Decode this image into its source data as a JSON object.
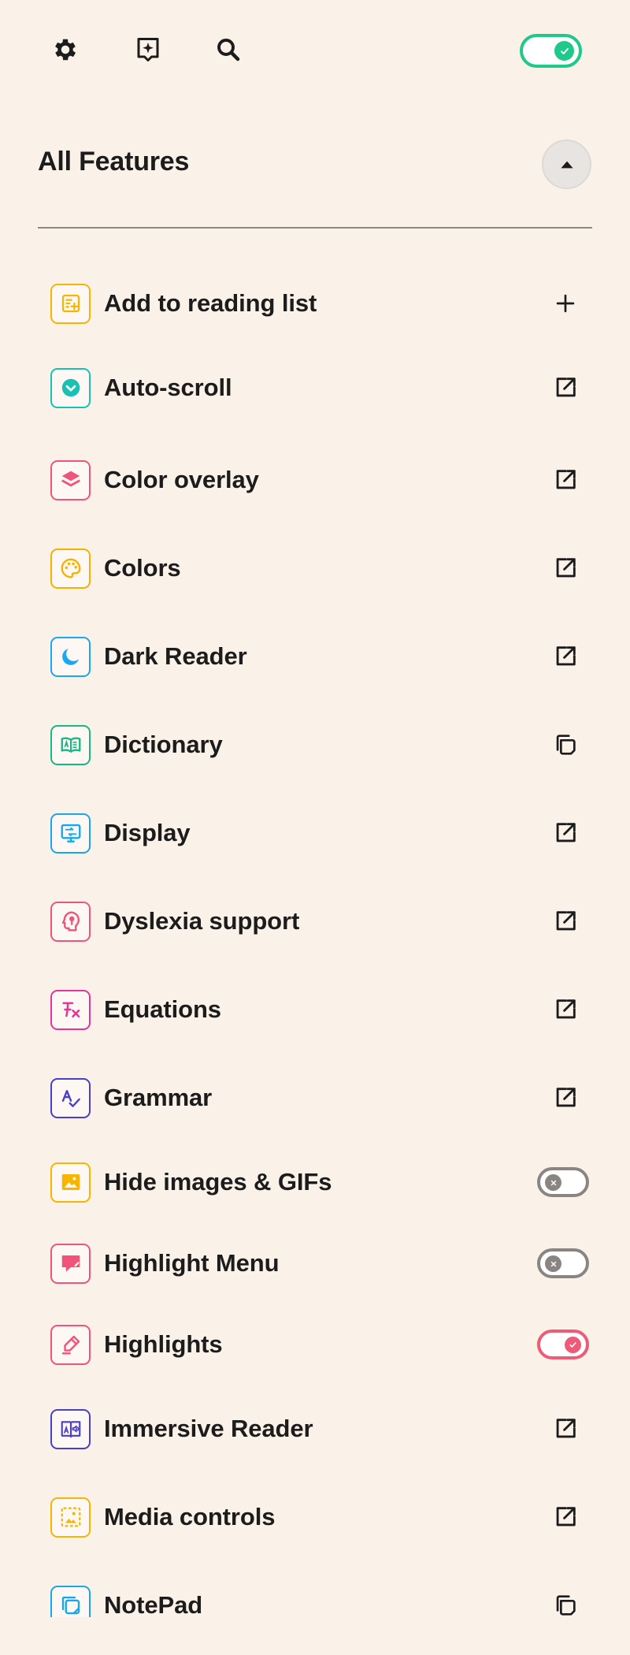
{
  "toolbar": {
    "icons": [
      "gear-icon",
      "sparkle-icon",
      "search-icon"
    ],
    "master_toggle": {
      "state": "on",
      "color": "#1ec98a"
    }
  },
  "section": {
    "title": "All Features",
    "collapse_icon": "caret-up-icon"
  },
  "features": [
    {
      "label": "Add to reading list",
      "icon": "reading-list-icon",
      "color": "#f7b500",
      "action": "add"
    },
    {
      "label": "Auto-scroll",
      "icon": "chevron-circle-icon",
      "color": "#18c1b2",
      "action": "open"
    },
    {
      "label": "Color overlay",
      "icon": "layers-icon",
      "color": "#f1547a",
      "action": "open"
    },
    {
      "label": "Colors",
      "icon": "palette-icon",
      "color": "#f5b100",
      "action": "open"
    },
    {
      "label": "Dark Reader",
      "icon": "moon-icon",
      "color": "#1aa8f0",
      "action": "open"
    },
    {
      "label": "Dictionary",
      "icon": "book-icon",
      "color": "#18b886",
      "action": "copy"
    },
    {
      "label": "Display",
      "icon": "monitor-icon",
      "color": "#19a7ec",
      "action": "open"
    },
    {
      "label": "Dyslexia support",
      "icon": "head-icon",
      "color": "#f1547a",
      "action": "open"
    },
    {
      "label": "Equations",
      "icon": "function-icon",
      "color": "#e6359a",
      "action": "open"
    },
    {
      "label": "Grammar",
      "icon": "spellcheck-icon",
      "color": "#4a3fc9",
      "action": "open"
    },
    {
      "label": "Hide images & GIFs",
      "icon": "image-icon",
      "color": "#f7b500",
      "action": "toggle",
      "state": "off"
    },
    {
      "label": "Highlight Menu",
      "icon": "comment-icon",
      "color": "#f1547a",
      "action": "toggle",
      "state": "off"
    },
    {
      "label": "Highlights",
      "icon": "highlighter-icon",
      "color": "#f1547a",
      "action": "toggle",
      "state": "on"
    },
    {
      "label": "Immersive Reader",
      "icon": "immersive-reader-icon",
      "color": "#4a3fc9",
      "action": "open"
    },
    {
      "label": "Media controls",
      "icon": "media-icon",
      "color": "#f7b500",
      "action": "open"
    },
    {
      "label": "NotePad",
      "icon": "notepad-icon",
      "color": "#19a7ec",
      "action": "copy"
    }
  ]
}
